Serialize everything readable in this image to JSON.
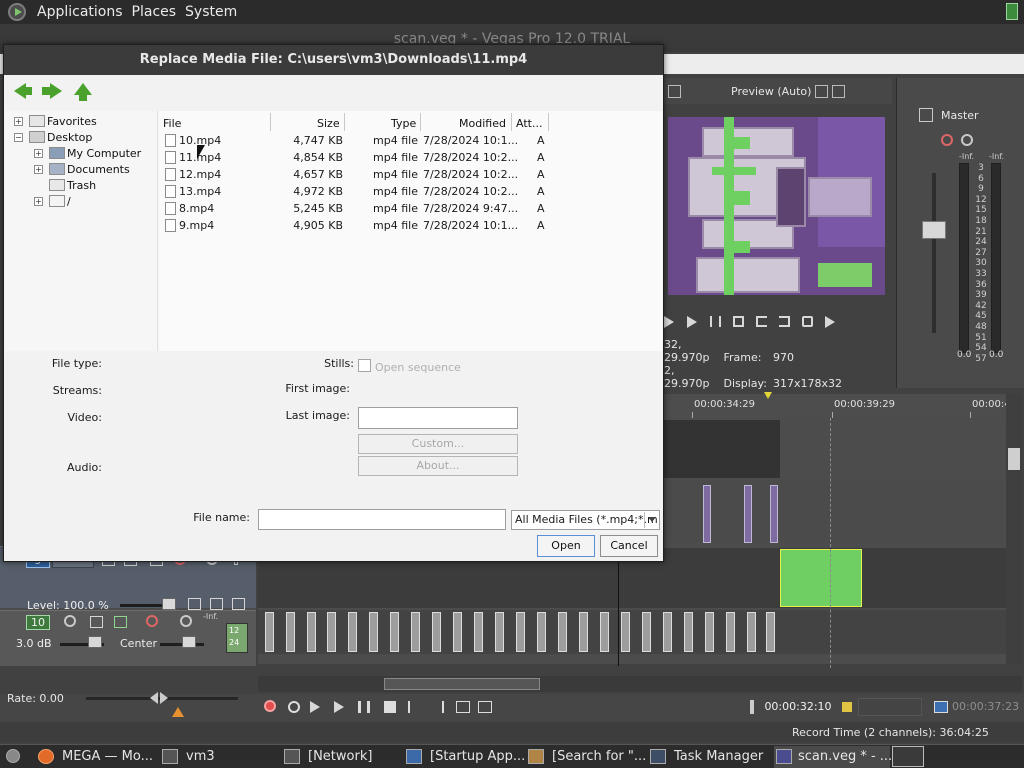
{
  "top_panel": {
    "menus": [
      "Applications",
      "Places",
      "System"
    ]
  },
  "vegas": {
    "window_title": "scan.veg * - Vegas Pro 12.0 TRIAL",
    "preview": {
      "mode": "Preview (Auto)",
      "info_line1_left": "32, 29.970p",
      "info_line1_label": "Frame:",
      "info_line1_value": "970",
      "info_line2_left": "2, 29.970p",
      "info_line2_label": "Display:",
      "info_line2_value": "317x178x32"
    },
    "master": {
      "label": "Master",
      "inf_left": "-Inf.",
      "inf_right": "-Inf.",
      "zero_left": "0.0",
      "zero_right": "0.0",
      "scale": [
        "3",
        "6",
        "9",
        "12",
        "15",
        "18",
        "21",
        "24",
        "27",
        "30",
        "33",
        "36",
        "39",
        "42",
        "45",
        "48",
        "51",
        "54",
        "57"
      ]
    },
    "timeline": {
      "ruler_times": [
        "00:00:34:29",
        "00:00:39:29",
        "00:00:4"
      ]
    },
    "tracks": {
      "track1_num": "9",
      "track1_level": "Level: 100.0 %",
      "track2_num": "10",
      "track2_volume": "3.0 dB",
      "track2_pan": "Center",
      "track2_meter_top": "-Inf.",
      "track2_meter_a": "12",
      "track2_meter_b": "24"
    },
    "transport": {
      "rate": "Rate: 0.00",
      "timecode": "00:00:32:10",
      "timecode_end": "00:00:37:23",
      "record_time": "Record Time (2 channels): 36:04:25"
    }
  },
  "dialog": {
    "title": "Replace Media File: C:\\users\\vm3\\Downloads\\11.mp4",
    "tree": [
      {
        "label": "Favorites",
        "expander": "+"
      },
      {
        "label": "Desktop",
        "expander": "−"
      },
      {
        "label": "My Computer",
        "expander": "+"
      },
      {
        "label": "Documents",
        "expander": "+"
      },
      {
        "label": "Trash",
        "expander": ""
      },
      {
        "label": "/",
        "expander": "+"
      }
    ],
    "columns": {
      "file": "File",
      "size": "Size",
      "type": "Type",
      "modified": "Modified",
      "attr": "Att..."
    },
    "files": [
      {
        "name": "10.mp4",
        "size": "4,747 KB",
        "type": "mp4 file",
        "modified": "7/28/2024 10:1...",
        "attr": "A"
      },
      {
        "name": "11.mp4",
        "size": "4,854 KB",
        "type": "mp4 file",
        "modified": "7/28/2024 10:2...",
        "attr": "A"
      },
      {
        "name": "12.mp4",
        "size": "4,657 KB",
        "type": "mp4 file",
        "modified": "7/28/2024 10:2...",
        "attr": "A"
      },
      {
        "name": "13.mp4",
        "size": "4,972 KB",
        "type": "mp4 file",
        "modified": "7/28/2024 10:2...",
        "attr": "A"
      },
      {
        "name": "8.mp4",
        "size": "5,245 KB",
        "type": "mp4 file",
        "modified": "7/28/2024 9:47...",
        "attr": "A"
      },
      {
        "name": "9.mp4",
        "size": "4,905 KB",
        "type": "mp4 file",
        "modified": "7/28/2024 10:1...",
        "attr": "A"
      }
    ],
    "labels": {
      "file_type": "File type:",
      "streams": "Streams:",
      "video": "Video:",
      "audio": "Audio:",
      "stills": "Stills:",
      "open_sequence": "Open sequence",
      "first_image": "First image:",
      "last_image": "Last image:",
      "custom": "Custom...",
      "about": "About...",
      "file_name": "File name:"
    },
    "file_name_value": "",
    "filter": "All Media Files (*.mp4;*.m",
    "open_button": "Open",
    "cancel_button": "Cancel"
  },
  "taskbar": {
    "tasks": [
      "MEGA — Mo...",
      "vm3",
      "[Network]",
      "[Startup App...",
      "[Search for \"...",
      "Task Manager",
      "scan.veg * - ..."
    ]
  },
  "colors": {
    "accent_green": "#4aa22c",
    "record_red": "#e14d4d",
    "clip_green": "#6fcf62"
  }
}
